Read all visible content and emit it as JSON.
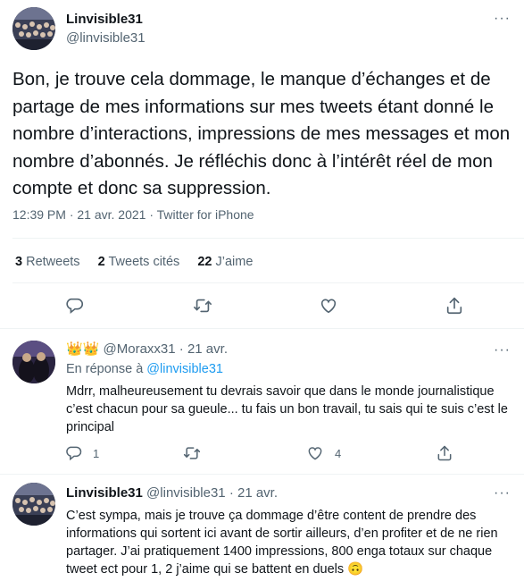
{
  "main_tweet": {
    "author_name": "Linvisible31",
    "author_handle": "@linvisible31",
    "text": "Bon, je trouve cela dommage, le manque d’échanges et de partage de mes informations sur mes tweets étant donné le nombre d’interactions, impressions de mes messages et mon nombre d’abonnés. Je réfléchis donc à l’intérêt réel de mon compte et donc sa suppression.",
    "time": "12:39 PM · 21 avr. 2021 ·",
    "source": "Twitter for iPhone",
    "stats": {
      "retweets_count": "3",
      "retweets_label": "Retweets",
      "quotes_count": "2",
      "quotes_label": "Tweets cités",
      "likes_count": "22",
      "likes_label": "J’aime"
    },
    "actions": [
      "reply-icon",
      "retweet-icon",
      "like-icon",
      "share-icon"
    ]
  },
  "replies": [
    {
      "emoji": "👑👑",
      "author_handle": "@Moraxx31",
      "time": "· 21 avr.",
      "reply_prefix": "En réponse à",
      "reply_to": "@linvisible31",
      "text": "Mdrr, malheureusement tu devrais savoir que dans le monde journalistique c’est chacun pour sa gueule... tu fais un bon travail, tu sais qui te suis c’est le principal",
      "reply_count": "1",
      "retweet_count": "",
      "like_count": "4"
    },
    {
      "author_name": "Linvisible31",
      "author_handle": "@linvisible31",
      "time": "· 21 avr.",
      "text": "C’est sympa, mais je trouve ça dommage d’être content de prendre des informations qui sortent ici avant de sortir ailleurs, d’en profiter et de ne rien partager. J’ai pratiquement 1400 impressions, 800 enga totaux sur chaque tweet ect pour 1, 2 j’aime qui se battent en duels",
      "emoji_end": "🙃"
    }
  ],
  "colors": {
    "accent": "#1d9bf0",
    "secondary_text": "#536471",
    "divider": "#eff3f4",
    "emoji_gold": "#f4b400"
  }
}
